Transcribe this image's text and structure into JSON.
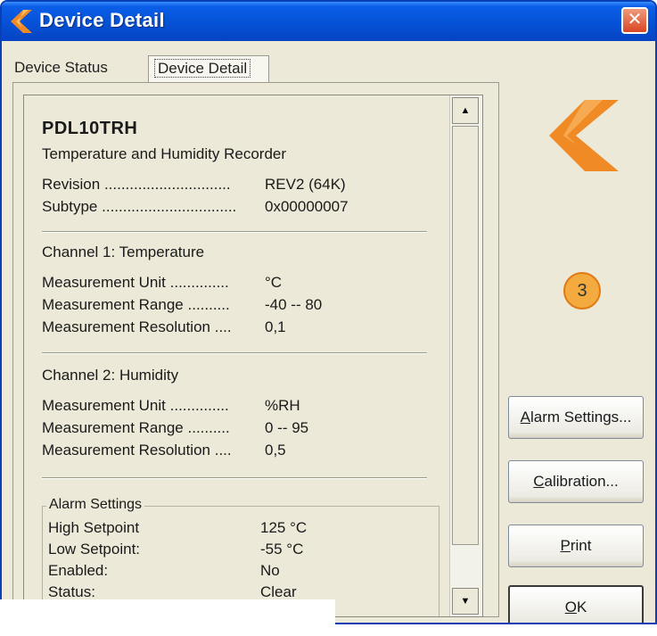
{
  "window": {
    "title": "Device Detail",
    "close_glyph": "✕"
  },
  "tabs": [
    {
      "label": "Device Status",
      "selected": false
    },
    {
      "label": "Device Detail",
      "selected": true
    }
  ],
  "device": {
    "model": "PDL10TRH",
    "description": "Temperature and Humidity Recorder",
    "rows": [
      {
        "label": "Revision",
        "dots": "..............................",
        "value": "REV2 (64K)"
      },
      {
        "label": "Subtype",
        "dots": "................................",
        "value": "0x00000007"
      }
    ]
  },
  "channels": [
    {
      "heading": "Channel 1: Temperature",
      "rows": [
        {
          "label": "Measurement Unit",
          "dots": "..............",
          "value": "°C"
        },
        {
          "label": "Measurement Range",
          "dots": "..........",
          "value": "-40 -- 80"
        },
        {
          "label": "Measurement Resolution",
          "dots": "....",
          "value": "0,1"
        }
      ]
    },
    {
      "heading": "Channel 2: Humidity",
      "rows": [
        {
          "label": "Measurement Unit",
          "dots": "..............",
          "value": "%RH"
        },
        {
          "label": "Measurement Range",
          "dots": "..........",
          "value": "0 -- 95"
        },
        {
          "label": "Measurement Resolution",
          "dots": "....",
          "value": "0,5"
        }
      ]
    }
  ],
  "alarm": {
    "title": "Alarm Settings",
    "rows": [
      {
        "label": "High Setpoint",
        "value": "125 °C"
      },
      {
        "label": "Low Setpoint:",
        "value": "-55 °C"
      },
      {
        "label": "Enabled:",
        "value": "No"
      },
      {
        "label": "Status:",
        "value": "Clear"
      }
    ]
  },
  "callout": "3",
  "buttons": {
    "alarm_settings": {
      "mnemonic": "A",
      "rest": "larm Settings..."
    },
    "calibration": {
      "mnemonic": "C",
      "rest": "alibration..."
    },
    "print": {
      "mnemonic": "P",
      "rest": "rint"
    },
    "ok": {
      "mnemonic": "O",
      "rest": "K"
    }
  },
  "scrollbar": {
    "up_glyph": "▲",
    "down_glyph": "▼"
  },
  "colors": {
    "title_bar": "#0551d6",
    "logo_orange": "#f08a24",
    "callout_fill": "#f3aa3e",
    "window_bg": "#ece9d8"
  },
  "icons": {
    "title": "app-logo-icon",
    "close": "close-icon",
    "brand": "brand-logo-icon"
  }
}
